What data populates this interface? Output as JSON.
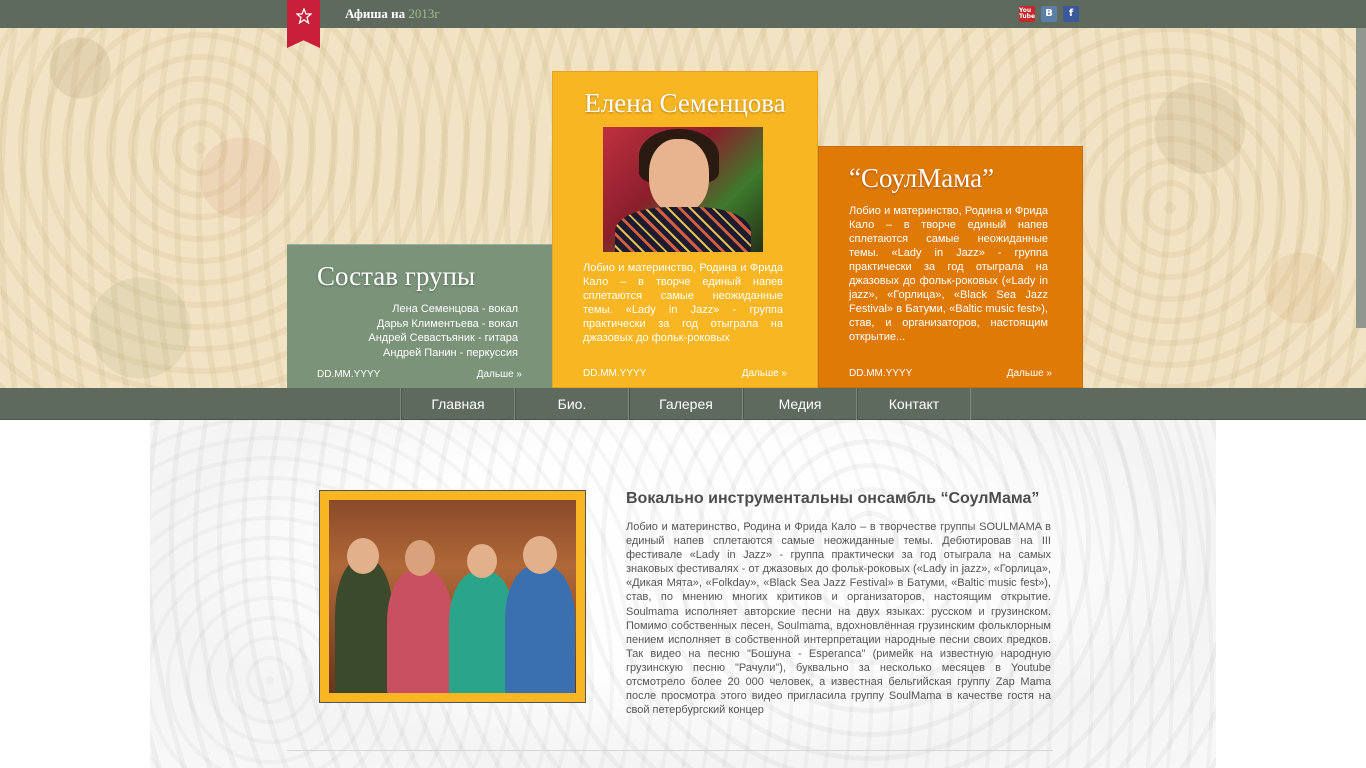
{
  "topbar": {
    "afisha_label": "Афиша на",
    "afisha_year": "2013г",
    "socials": [
      "You Tube",
      "В",
      "f"
    ]
  },
  "panels": {
    "members": {
      "title": "Состав групы",
      "items": [
        "Лена Семенцова - вокал",
        "Дарья Климентьева - вокал",
        "Андрей Севастьяник - гитара",
        "Андрей Панин - перкуссия"
      ],
      "date": "DD.MM.YYYY",
      "more": "Дальше »"
    },
    "singer": {
      "title": "Елена Семенцова",
      "text": "Лобио и материнство, Родина и Фрида Кало – в творче единый напев сплетаются самые неожиданные темы. «Lady in Jazz» - группа практически за год отыграла на джазовых до фольк-роковых",
      "date": "DD.MM.YYYY",
      "more": "Дальше »"
    },
    "band": {
      "title": "“СоулМама”",
      "text": "Лобио и материнство, Родина и Фрида Кало – в творче единый напев сплетаются самые неожиданные темы. «Lady in Jazz» - группа практически за год отыграла на джазовых до фольк-роковых («Lady in jazz», «Горлица», «Black Sea Jazz Festival» в Батуми, «Baltic music fest»), став, и организаторов, настоящим открытие...",
      "date": "DD.MM.YYYY",
      "more": "Дальше »"
    }
  },
  "nav": [
    "Главная",
    "Био.",
    "Галерея",
    "Медия",
    "Контакт"
  ],
  "content": {
    "title": "Вокально инструментальны онсамбль “СоулМама”",
    "text": "Лобио и материнство, Родина и Фрида Кало – в творчестве группы SOULMAMA в единый напев сплетаются самые неожиданные темы. Дебютировав на III фестивале «Lady in Jazz» - группа практически за год отыграла на самых знаковых фестивалях - от джазовых до фольк-роковых («Lady in jazz», «Горлица», «Дикая Мята», «Folkday», «Black Sea Jazz Festival» в Батуми, «Baltic music fest»), став, по мнению многих критиков и организаторов, настоящим открытие. Soulmama исполняет авторские песни на двух языках: русском и грузинском. Помимо собственных песен, Soulmama, вдохновлённая грузинским фольклорным пением исполняет в собственной интерпретации народные песни своих предков. Так видео на песню \"Бошуна - Esperanca\" (римейк на известную народную грузинскую песню \"Рачули\"), буквально за несколько месяцев в Youtube отсмотрело более 20 000 человек, а известная бельгийская группу Zap Mama после просмотра этого видео пригласила группу SoulMama в качестве гостя на свой петербургский концер"
  },
  "colors": {
    "bar": "#5e6a5e",
    "ribbon": "#c8203a",
    "green_panel": "#7a9379",
    "yellow_panel": "#f8b623",
    "orange_panel": "#df7a06"
  },
  "icons": [
    "star-icon",
    "youtube-icon",
    "vk-icon",
    "facebook-icon"
  ]
}
